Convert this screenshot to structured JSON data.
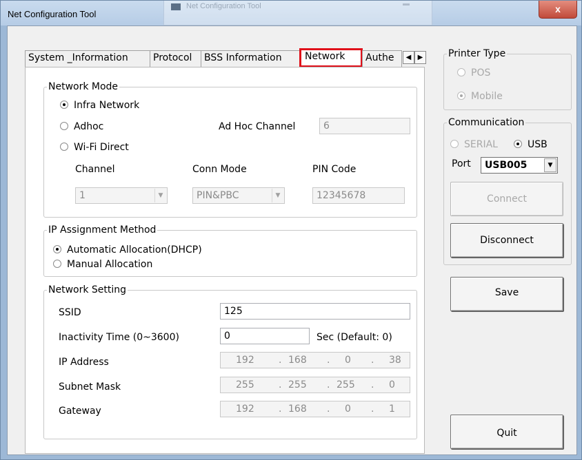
{
  "window": {
    "title": "Net Configuration Tool",
    "ghost_title": "Net Configuration Tool",
    "close_glyph": "x"
  },
  "tabs": [
    {
      "label": "System _Information"
    },
    {
      "label": "Protocol"
    },
    {
      "label": "BSS Information"
    },
    {
      "label": "Network",
      "active": true
    },
    {
      "label": "Authe"
    }
  ],
  "tab_scroll": {
    "left": "◀",
    "right": "▶"
  },
  "network_mode": {
    "legend": "Network Mode",
    "infra": "Infra Network",
    "adhoc": "Adhoc",
    "wifi_direct": "Wi-Fi Direct",
    "adhoc_channel_label": "Ad Hoc Channel",
    "adhoc_channel_value": "6",
    "channel_label": "Channel",
    "channel_value": "1",
    "conn_mode_label": "Conn Mode",
    "conn_mode_value": "PIN&PBC",
    "pin_code_label": "PIN Code",
    "pin_code_value": "12345678"
  },
  "ip_assignment": {
    "legend": "IP Assignment Method",
    "auto": "Automatic Allocation(DHCP)",
    "manual": "Manual Allocation"
  },
  "network_setting": {
    "legend": "Network Setting",
    "ssid_label": "SSID",
    "ssid_value": "125",
    "inactivity_label": "Inactivity Time (0~3600)",
    "inactivity_value": "0",
    "inactivity_suffix": "Sec (Default: 0)",
    "ip_label": "IP Address",
    "ip": [
      "192",
      "168",
      "0",
      "38"
    ],
    "subnet_label": "Subnet Mask",
    "subnet": [
      "255",
      "255",
      "255",
      "0"
    ],
    "gateway_label": "Gateway",
    "gateway": [
      "192",
      "168",
      "0",
      "1"
    ]
  },
  "printer_type": {
    "legend": "Printer Type",
    "pos": "POS",
    "mobile": "Mobile"
  },
  "communication": {
    "legend": "Communication",
    "serial": "SERIAL",
    "usb": "USB",
    "port_label": "Port",
    "port_value": "USB005"
  },
  "buttons": {
    "connect": "Connect",
    "disconnect": "Disconnect",
    "save": "Save",
    "quit": "Quit"
  }
}
